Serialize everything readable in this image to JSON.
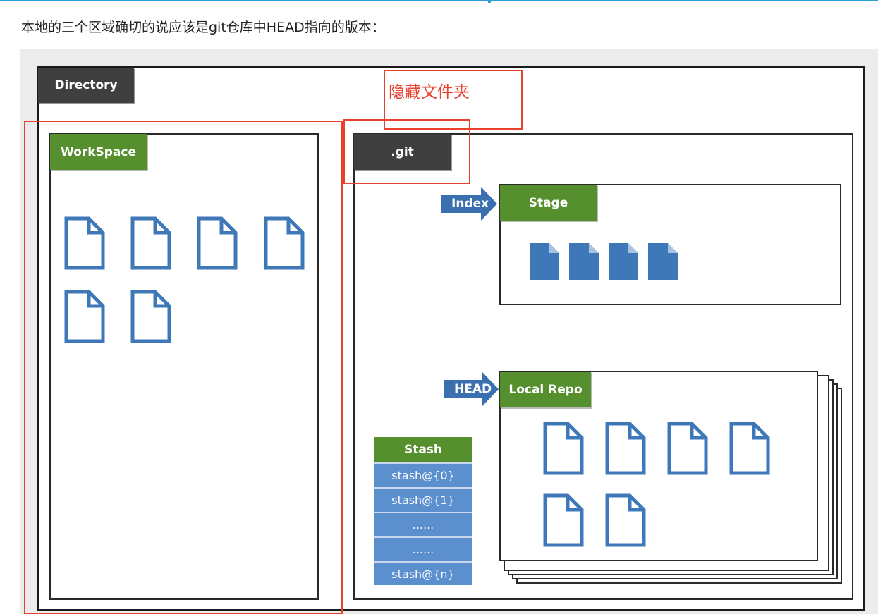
{
  "intro": {
    "text": "本地的三个区域确切的说应该是git仓库中HEAD指向的版本："
  },
  "diagram": {
    "directory_label": "Directory",
    "workspace_label": "WorkSpace",
    "git_label": ".git",
    "hidden_folder_note": "隐藏文件夹",
    "index_label": "Index",
    "stage_label": "Stage",
    "head_label": "HEAD",
    "local_repo_label": "Local Repo",
    "stash": {
      "title": "Stash",
      "entries": [
        "stash@{0}",
        "stash@{1}",
        "......",
        "......",
        "stash@{n}"
      ]
    }
  },
  "colors": {
    "green_label": "#56902e",
    "dark_label": "#3f3f3f",
    "file_blue": "#3f78b8",
    "arrow_blue": "#3a6fb0",
    "stash_blue": "#5b8fce",
    "highlight_red": "#e8412d",
    "link_blue": "#2a9fd6"
  },
  "icons": {
    "workspace_files": "file-outline-icon",
    "stage_files": "file-filled-icon",
    "repo_files": "file-outline-icon",
    "pointer": "arrow-right-icon"
  }
}
